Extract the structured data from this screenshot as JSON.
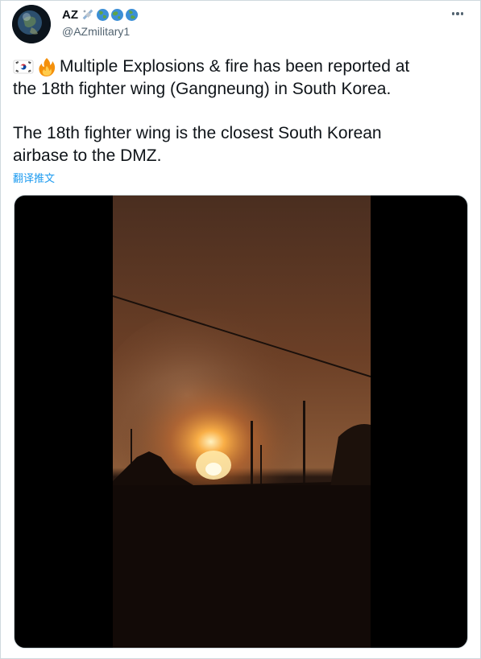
{
  "author": {
    "display_name": "AZ",
    "handle": "@AZmilitary1",
    "name_emojis": [
      "satellite-icon",
      "globe-icon",
      "globe-icon",
      "globe-icon"
    ]
  },
  "tweet": {
    "line1": "Multiple Explosions & fire has been reported at",
    "line2": "the 18th fighter wing (Gangneung) in South Korea.",
    "line3": "The 18th fighter wing is the closest South Korean",
    "line4": "airbase to the DMZ.",
    "leading_emojis": [
      "south-korea-flag-icon",
      "fire-icon"
    ],
    "translate_label": "翻译推文"
  },
  "colors": {
    "text": "#0f1419",
    "secondary": "#536471",
    "link": "#1d9bf0",
    "border": "#cfd9de"
  }
}
